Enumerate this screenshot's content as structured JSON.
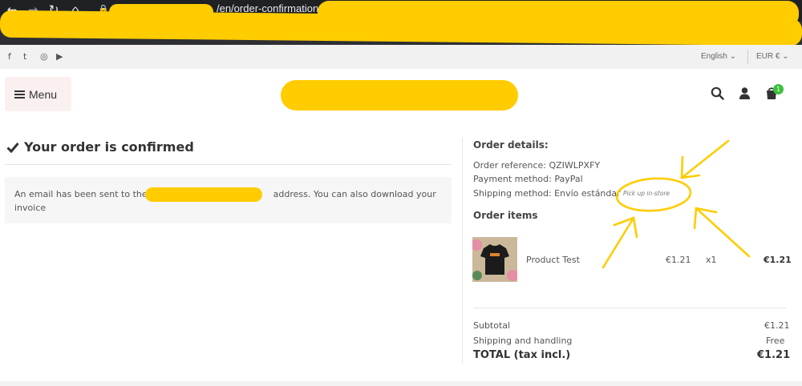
{
  "browser": {
    "url_visible": "/en/order-confirmation?"
  },
  "topbar": {
    "language": "English ⌄",
    "currency": "EUR € ⌄"
  },
  "header": {
    "menu_label": "Menu",
    "cart_count": "1"
  },
  "confirmation": {
    "title": "Your order is confirmed",
    "email_prefix": "An email has been sent to the",
    "email_suffix": "address. You can also download your",
    "invoice_link": "invoice"
  },
  "order_details": {
    "title": "Order details:",
    "reference": "Order reference: QZIWLPXFY",
    "payment": "Payment method: PayPal",
    "shipping": "Shipping method: Envío estándar",
    "pickup_note": "Pick up in-store"
  },
  "order_items": {
    "title": "Order items",
    "items": [
      {
        "name": "Product Test",
        "unit_price": "€1.21",
        "qty": "x1",
        "total": "€1.21"
      }
    ]
  },
  "totals": {
    "subtotal_label": "Subtotal",
    "subtotal_value": "€1.21",
    "shipping_label": "Shipping and handling",
    "shipping_value": "Free",
    "total_label": "TOTAL (tax incl.)",
    "total_value": "€1.21"
  },
  "colors": {
    "redaction": "#ffcc00",
    "success_badge": "#3cc13c"
  }
}
